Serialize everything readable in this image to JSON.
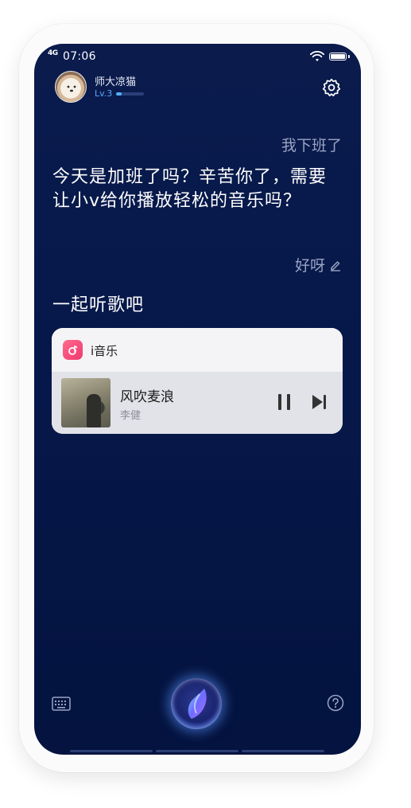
{
  "status_bar": {
    "signal": "4G",
    "time": "07:06"
  },
  "user": {
    "name": "师大凉猫",
    "level": "Lv.3",
    "level_progress": 0.2
  },
  "conversation": {
    "user_message_1": "我下班了",
    "assistant_message_1": "今天是加班了吗？辛苦你了，需要让小v给你播放轻松的音乐吗？",
    "user_message_2": "好呀",
    "assistant_message_2": "一起听歌吧"
  },
  "music_card": {
    "app_name": "i音乐",
    "song_title": "风吹麦浪",
    "artist": "李健"
  },
  "colors": {
    "background": "#06184a",
    "accent": "#4fb1ff",
    "music_app": "#f0386f"
  }
}
